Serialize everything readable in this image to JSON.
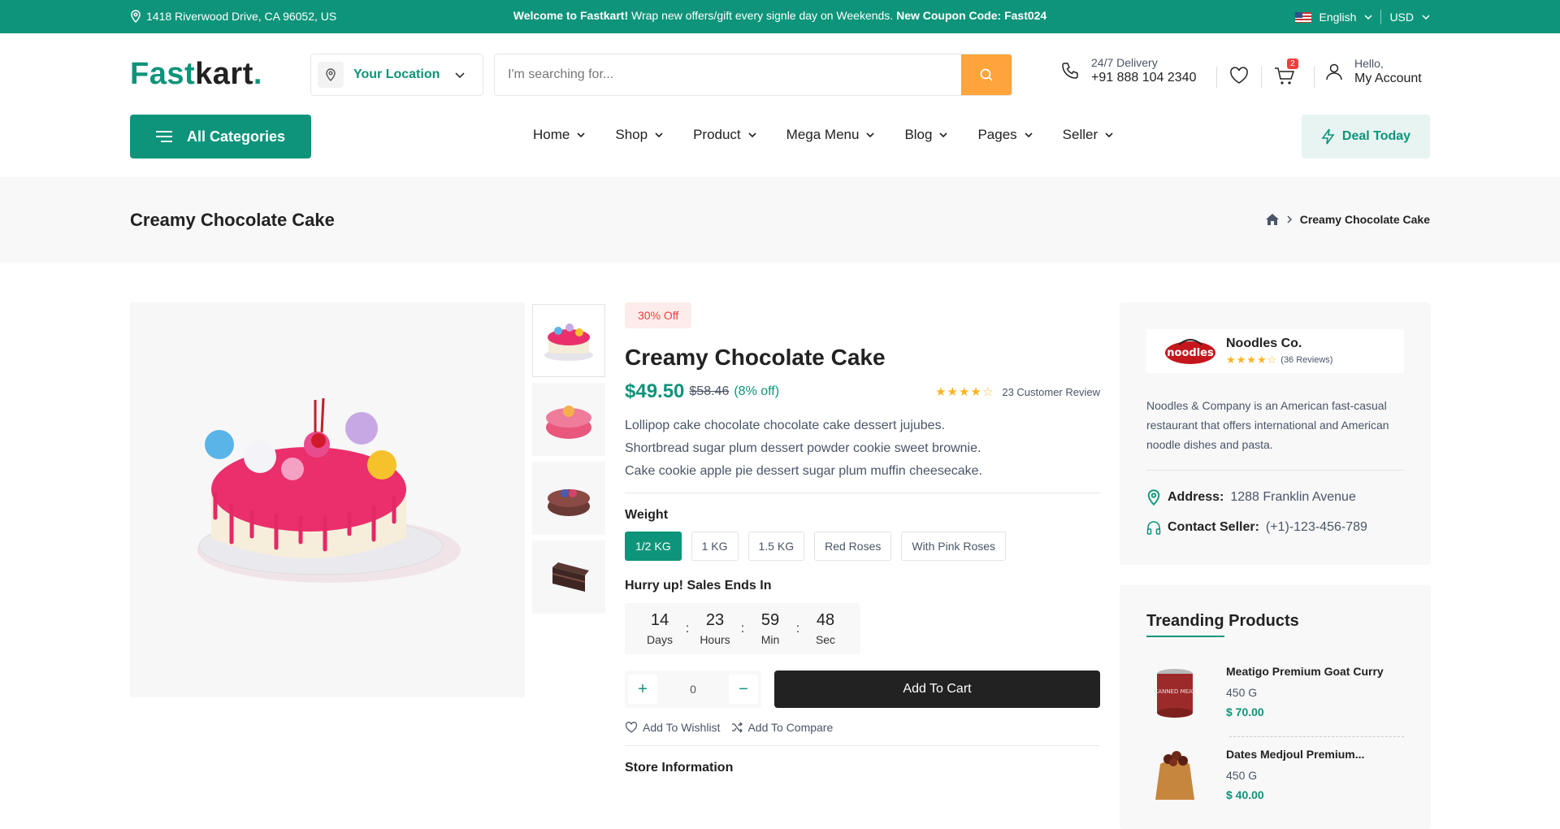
{
  "topbar": {
    "address": "1418 Riverwood Drive, CA 96052, US",
    "welcome_bold": "Welcome to Fastkart!",
    "welcome_text": " Wrap new offers/gift every signle day on Weekends. ",
    "coupon": "New Coupon Code: Fast024",
    "language": "English",
    "currency": "USD"
  },
  "header": {
    "logo_a": "Fast",
    "logo_b": "kart",
    "logo_dot": ".",
    "location_label": "Your Location",
    "search_placeholder": "I'm searching for...",
    "delivery_label": "24/7 Delivery",
    "delivery_phone": "+91 888 104 2340",
    "cart_count": "2",
    "account_hello": "Hello,",
    "account_label": "My Account",
    "all_categories": "All Categories",
    "nav": [
      "Home",
      "Shop",
      "Product",
      "Mega Menu",
      "Blog",
      "Pages",
      "Seller"
    ],
    "deal_today": "Deal Today"
  },
  "breadcrumb": {
    "page_title": "Creamy Chocolate Cake",
    "current": "Creamy Chocolate Cake"
  },
  "product": {
    "discount_badge": "30% Off",
    "title": "Creamy Chocolate Cake",
    "price": "$49.50",
    "old_price": "$58.46",
    "percent_off": "(8% off)",
    "rating": 4,
    "review_text": "23 Customer Review",
    "description": [
      "Lollipop cake chocolate chocolate cake dessert jujubes.",
      "Shortbread sugar plum dessert powder cookie sweet brownie.",
      "Cake cookie apple pie dessert sugar plum muffin cheesecake."
    ],
    "weight_label": "Weight",
    "weight_options": [
      "1/2 KG",
      "1 KG",
      "1.5 KG",
      "Red Roses",
      "With Pink Roses"
    ],
    "selected_weight": "1/2 KG",
    "sale_label": "Hurry up! Sales Ends In",
    "timer": {
      "days": "14",
      "days_label": "Days",
      "hours": "23",
      "hours_label": "Hours",
      "min": "59",
      "min_label": "Min",
      "sec": "48",
      "sec_label": "Sec"
    },
    "quantity": "0",
    "add_to_cart": "Add To Cart",
    "wishlist": "Add To Wishlist",
    "compare": "Add To Compare",
    "store_info": "Store Information"
  },
  "vendor": {
    "logo_text": "noodles",
    "name": "Noodles Co.",
    "rating": 4,
    "reviews": "(36 Reviews)",
    "description": "Noodles & Company is an American fast-casual restaurant that offers international and American noodle dishes and pasta.",
    "address_label": "Address:",
    "address": "1288 Franklin Avenue",
    "contact_label": "Contact Seller:",
    "contact": "(+1)-123-456-789"
  },
  "trending": {
    "title": "Treanding Products",
    "items": [
      {
        "name": "Meatigo Premium Goat Curry",
        "weight": "450 G",
        "price": "$ 70.00",
        "img_text": "CANNED MEAT"
      },
      {
        "name": "Dates Medjoul Premium...",
        "weight": "450 G",
        "price": "$ 40.00"
      }
    ]
  },
  "colors": {
    "brand": "#0e947a",
    "accent": "#ffa53b",
    "danger": "#ef3f3e",
    "dark": "#222222"
  }
}
